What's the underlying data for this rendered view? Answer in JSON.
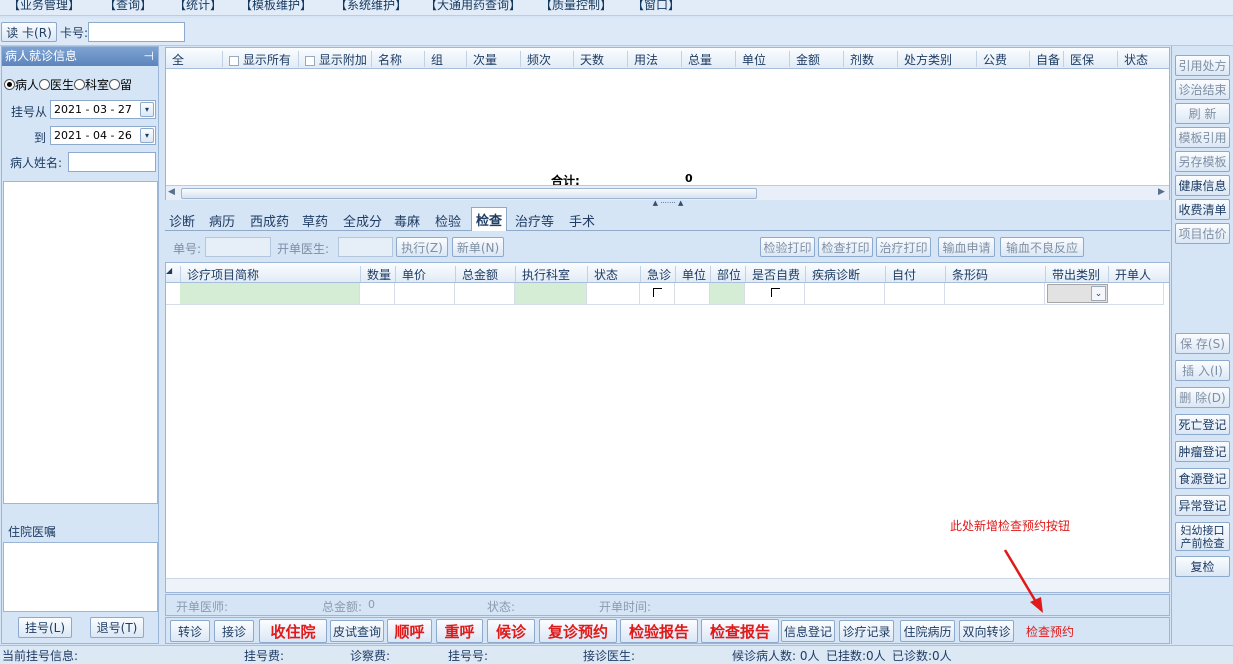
{
  "menu": [
    "【业务管理】",
    "【查询】",
    "【统计】",
    "【模板维护】",
    "【系统维护】",
    "【大通用药查询】",
    "【质量控制】",
    "【窗口】"
  ],
  "toolbar": {
    "read_card": "读 卡(R)",
    "card_no_label": "卡号:"
  },
  "left_panel": {
    "title": "病人就诊信息",
    "pin": "⊣",
    "radio_options": [
      "病人",
      "医生",
      "科室",
      "留"
    ],
    "reg_from_label": "挂号从",
    "reg_from_value": "2021 - 03 - 27",
    "reg_to_label": "到",
    "reg_to_value": "2021 - 04 - 26",
    "patient_name_label": "病人姓名:",
    "hospital_advice_label": "住院医嘱",
    "register_button": "挂号(L)",
    "unregister_button": "退号(T)"
  },
  "rx_grid": {
    "columns": [
      "全",
      "显示所有",
      "显示附加",
      "名称",
      "组",
      "次量",
      "频次",
      "天数",
      "用法",
      "总量",
      "单位",
      "金额",
      "剂数",
      "处方类别",
      "公费",
      "自备",
      "医保",
      "状态"
    ],
    "total_label": "合计:",
    "total_value": "0"
  },
  "tabs": [
    "诊断",
    "病历",
    "西成药",
    "草药",
    "全成分",
    "毒麻",
    "检验",
    "检查",
    "治疗等",
    "手术"
  ],
  "tab_selected": "检查",
  "exam_form": {
    "bill_no_label": "单号:",
    "doctor_label": "开单医生:",
    "execute_button": "执行(Z)",
    "new_button": "新单(N)",
    "lab_print": "检验打印",
    "exam_print": "检查打印",
    "treat_print": "治疗打印",
    "blood_apply": "输血申请",
    "blood_reaction": "输血不良反应"
  },
  "exam_grid": {
    "columns": [
      "诊疗项目简称",
      "数量",
      "单价",
      "总金额",
      "执行科室",
      "状态",
      "急诊",
      "单位",
      "部位",
      "是否自费",
      "疾病诊断",
      "自付",
      "条形码",
      "带出类别",
      "开单人"
    ]
  },
  "summary": {
    "doctor_label": "开单医师:",
    "total_label": "总金额:",
    "total_value": "0",
    "status_label": "状态:",
    "time_label": "开单时间:"
  },
  "bottom_buttons": {
    "transfer": "转诊",
    "receive": "接诊",
    "admit": "收住院",
    "skin_test": "皮试查询",
    "call_next": "顺呼",
    "recall": "重呼",
    "wait": "候诊",
    "revisit": "复诊预约",
    "lab_report": "检验报告",
    "exam_report": "检查报告",
    "info_register": "信息登记",
    "treat_record": "诊疗记录",
    "inpatient_record": "住院病历",
    "bidirectional": "双向转诊",
    "exam_booking": "检查预约"
  },
  "annotation": "此处新增检查预约按钮",
  "right_buttons_top": [
    "引用处方",
    "诊治结束",
    "刷 新",
    "模板引用",
    "另存模板",
    "健康信息",
    "收费清单",
    "项目估价"
  ],
  "right_buttons_bottom": [
    "保 存(S)",
    "插 入(I)",
    "删 除(D)",
    "死亡登记",
    "肿瘤登记",
    "食源登记",
    "异常登记",
    "妇幼接口 产前检查",
    "复检"
  ],
  "status_bar": {
    "current_reg": "当前挂号信息:",
    "reg_fee": "挂号费:",
    "diag_fee": "诊察费:",
    "reg_no": "挂号号:",
    "doctor": "接诊医生:",
    "waiting": "候诊病人数: 0人",
    "registered": "已挂数:0人",
    "diagnosed": "已诊数:0人"
  },
  "colors": {
    "accent_red": "#e01919",
    "panel_blue": "#d6e5f5",
    "header_blue": "#6a90c6"
  }
}
